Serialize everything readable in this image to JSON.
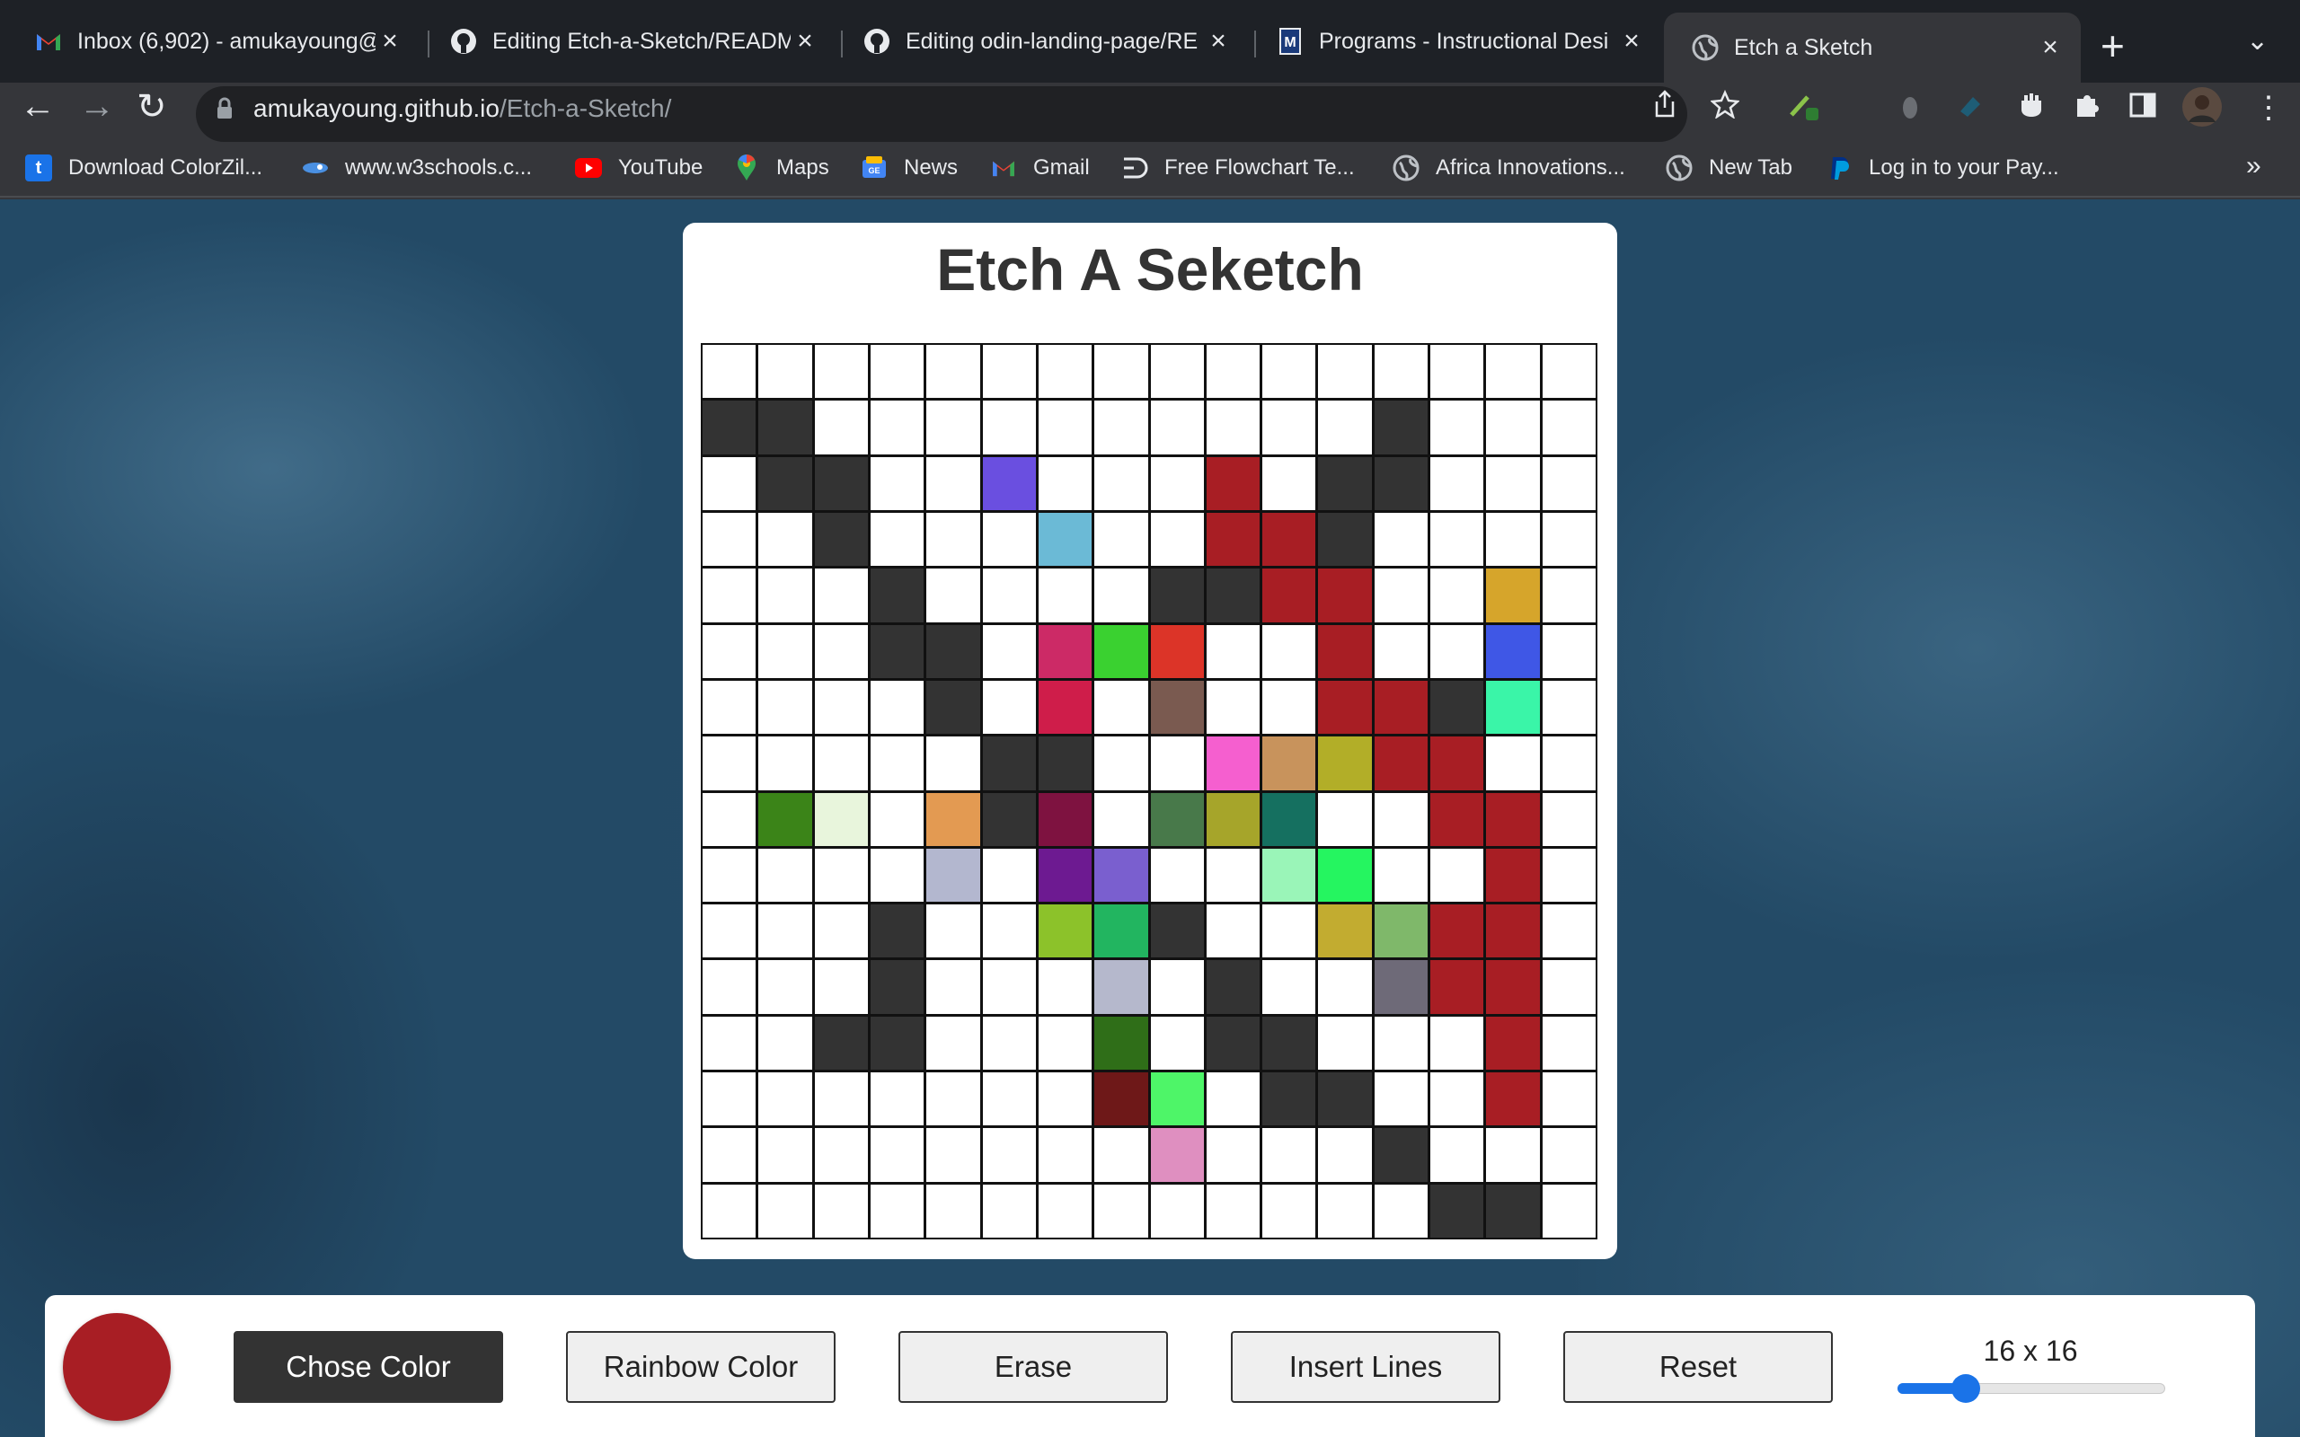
{
  "tabs": [
    {
      "title": "Inbox (6,902) - amukayoung@",
      "icon": "gmail-icon",
      "active": false
    },
    {
      "title": "Editing Etch-a-Sketch/READM",
      "icon": "github-icon",
      "active": false
    },
    {
      "title": "Editing odin-landing-page/RE",
      "icon": "github-icon",
      "active": false
    },
    {
      "title": "Programs - Instructional Desi",
      "icon": "university-icon",
      "active": false
    },
    {
      "title": "Etch a Sketch",
      "icon": "globe-icon",
      "active": true
    }
  ],
  "address_bar": {
    "host": "amukayoung.github.io",
    "path": "/Etch-a-Sketch/"
  },
  "bookmarks": [
    {
      "label": "Download ColorZil...",
      "icon": "colorzilla-icon"
    },
    {
      "label": "www.w3schools.c...",
      "icon": "w3schools-icon"
    },
    {
      "label": "YouTube",
      "icon": "youtube-icon"
    },
    {
      "label": "Maps",
      "icon": "maps-icon"
    },
    {
      "label": "News",
      "icon": "news-icon"
    },
    {
      "label": "Gmail",
      "icon": "gmail-icon"
    },
    {
      "label": "Free Flowchart Te...",
      "icon": "flowchart-icon"
    },
    {
      "label": "Africa Innovations...",
      "icon": "globe-icon"
    },
    {
      "label": "New Tab",
      "icon": "globe-icon"
    },
    {
      "label": "Log in to your Pay...",
      "icon": "paypal-icon"
    }
  ],
  "app": {
    "title": "Etch A Seketch",
    "grid_size": 16,
    "grid_colors": [
      [
        "W",
        "W",
        "W",
        "W",
        "W",
        "W",
        "W",
        "W",
        "W",
        "W",
        "W",
        "W",
        "W",
        "W",
        "W",
        "W"
      ],
      [
        "K",
        "K",
        "W",
        "W",
        "W",
        "W",
        "W",
        "W",
        "W",
        "W",
        "W",
        "W",
        "K",
        "W",
        "W",
        "W"
      ],
      [
        "W",
        "K",
        "K",
        "W",
        "W",
        "#6a4fe0",
        "W",
        "W",
        "W",
        "#a81e24",
        "W",
        "K",
        "K",
        "W",
        "W",
        "W"
      ],
      [
        "W",
        "W",
        "K",
        "W",
        "W",
        "W",
        "#6bbad6",
        "W",
        "W",
        "#a81e24",
        "#a81e24",
        "K",
        "W",
        "W",
        "W",
        "W"
      ],
      [
        "W",
        "W",
        "W",
        "K",
        "W",
        "W",
        "W",
        "W",
        "K",
        "K",
        "#a81e24",
        "#a81e24",
        "W",
        "W",
        "#d6a52b",
        "W"
      ],
      [
        "W",
        "W",
        "W",
        "K",
        "K",
        "W",
        "#cc2a66",
        "#3ad130",
        "#dc3428",
        "W",
        "W",
        "#a81e24",
        "W",
        "W",
        "#3f57e6",
        "W"
      ],
      [
        "W",
        "W",
        "W",
        "W",
        "K",
        "W",
        "#cf1d4a",
        "W",
        "#7a5a50",
        "W",
        "W",
        "#a81e24",
        "#a81e24",
        "K",
        "#3af5a8",
        "W"
      ],
      [
        "W",
        "W",
        "W",
        "W",
        "W",
        "K",
        "K",
        "W",
        "W",
        "#f55fcf",
        "#c8935c",
        "#b2ae28",
        "#a81e24",
        "#a81e24",
        "W",
        "W"
      ],
      [
        "W",
        "#3b8418",
        "#e8f5dc",
        "W",
        "#e39a52",
        "K",
        "#7e1240",
        "W",
        "#48794a",
        "#a6a52a",
        "#157060",
        "W",
        "W",
        "#a81e24",
        "#a81e24",
        "W"
      ],
      [
        "W",
        "W",
        "W",
        "W",
        "#b3b7cf",
        "W",
        "#6d1a91",
        "#7a5fcf",
        "W",
        "W",
        "#9af5b8",
        "#25f560",
        "W",
        "W",
        "#a81e24",
        "W"
      ],
      [
        "W",
        "W",
        "W",
        "K",
        "W",
        "W",
        "#8cc22a",
        "#22b560",
        "K",
        "W",
        "W",
        "#c2ac30",
        "#7fb86a",
        "#a81e24",
        "#a81e24",
        "W"
      ],
      [
        "W",
        "W",
        "W",
        "K",
        "W",
        "W",
        "W",
        "#b5b8cc",
        "W",
        "K",
        "W",
        "W",
        "#6e6a78",
        "#a81e24",
        "#a81e24",
        "W"
      ],
      [
        "W",
        "W",
        "K",
        "K",
        "W",
        "W",
        "W",
        "#2f6e18",
        "W",
        "K",
        "K",
        "W",
        "W",
        "W",
        "#a81e24",
        "W"
      ],
      [
        "W",
        "W",
        "W",
        "W",
        "W",
        "W",
        "W",
        "#6e1818",
        "#4ef568",
        "W",
        "K",
        "K",
        "W",
        "W",
        "#a81e24",
        "W"
      ],
      [
        "W",
        "W",
        "W",
        "W",
        "W",
        "W",
        "W",
        "W",
        "#df8fc0",
        "W",
        "W",
        "W",
        "K",
        "W",
        "W",
        "W"
      ],
      [
        "W",
        "W",
        "W",
        "W",
        "W",
        "W",
        "W",
        "W",
        "W",
        "W",
        "W",
        "W",
        "W",
        "K",
        "K",
        "W"
      ]
    ],
    "color_key": {
      "W": "#ffffff",
      "K": "#333333"
    },
    "selected_color": "#a81e24",
    "buttons": {
      "chose_color": "Chose Color",
      "rainbow": "Rainbow Color",
      "erase": "Erase",
      "insert_lines": "Insert Lines",
      "reset": "Reset"
    },
    "size_label": "16 x 16",
    "slider_value": 16,
    "slider_min": 2,
    "slider_max": 64
  }
}
